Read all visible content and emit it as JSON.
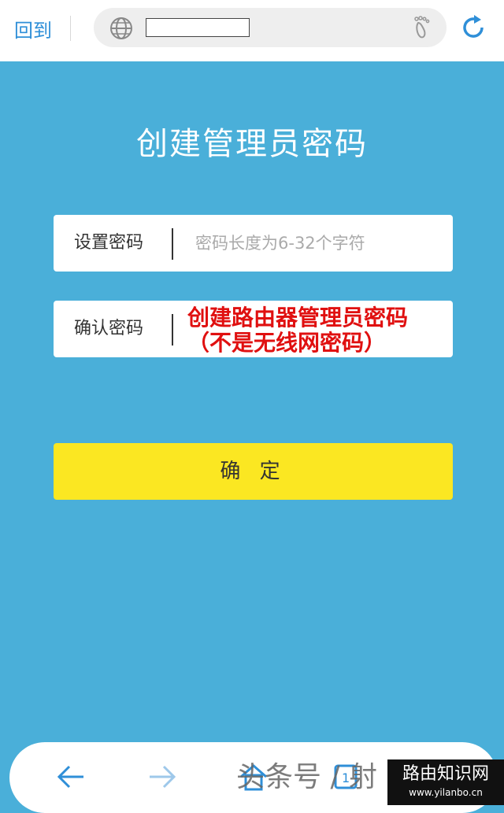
{
  "browser": {
    "back_label": "回到",
    "url": ""
  },
  "page": {
    "title": "创建管理员密码",
    "password_label": "设置密码",
    "password_placeholder": "密码长度为6-32个字符",
    "confirm_label": "确认密码",
    "annotation_line1": "创建路由器管理员密码",
    "annotation_line2": "（不是无线网密码）",
    "submit_label": "确 定"
  },
  "bottom": {
    "watermark": "头条号 / 射",
    "badge_title": "路由知识网",
    "badge_url": "www.yilanbo.cn"
  },
  "colors": {
    "background": "#4aafd9",
    "button": "#fbe722",
    "annotation": "#e01010",
    "link": "#2f8fd8"
  }
}
